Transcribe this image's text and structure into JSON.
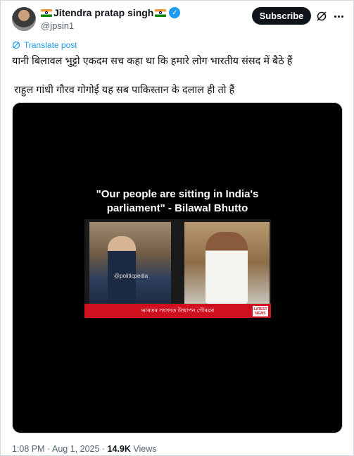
{
  "author": {
    "name": "Jitendra pratap singh",
    "handle": "@jpsin1"
  },
  "actions": {
    "subscribe_label": "Subscribe"
  },
  "post": {
    "line1": "यानी बिलावल भुट्टो एकदम सच कहा था कि हमारे लोग भारतीय संसद में बैठे हैं",
    "line2": "राहुल गांधी गौरव गोगोई यह सब पाकिस्तान के दलाल ही तो हैं",
    "translate_label": "Translate post"
  },
  "media": {
    "headline_line1": "\"Our people are sitting in India's",
    "headline_line2": "parliament\" - Bilawal Bhutto",
    "watermark": "@politicpedia",
    "ticker_text": "ভাৰতৰ সংসদত উত্থাপন গৌৰৱৰ",
    "badge_line1": "LATEST",
    "badge_line2": "NEWS"
  },
  "meta": {
    "time": "1:08 PM",
    "date": "Aug 1, 2025",
    "views_count": "14.9K",
    "views_label": "Views"
  },
  "colors": {
    "accent": "#1d9bf0",
    "subscribe_bg": "#0f1419",
    "text_secondary": "#536471"
  }
}
